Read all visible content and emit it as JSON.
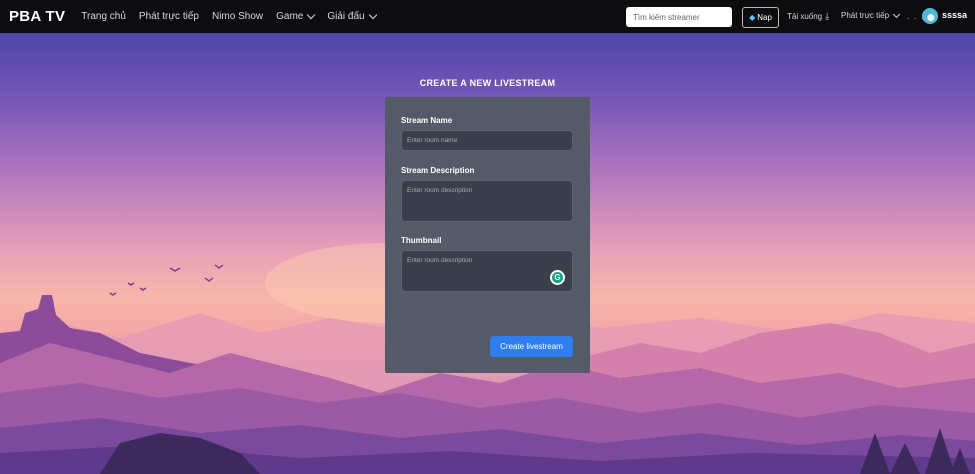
{
  "nav": {
    "logo": "PBA TV",
    "links": [
      "Trang chủ",
      "Phát trực tiếp",
      "Nimo Show",
      "Game",
      "Giải đấu"
    ],
    "search_placeholder": "Tìm kiếm streamer",
    "nap_label": "Nap",
    "download_label": "Tải xuống",
    "live_label": "Phát trực tiếp",
    "more_label": ". . .",
    "username": "ssssa"
  },
  "form": {
    "title": "CREATE A NEW LIVESTREAM",
    "stream_name_label": "Stream Name",
    "stream_name_placeholder": "Enter room name",
    "stream_description_label": "Stream Description",
    "stream_description_placeholder": "Enter room description",
    "thumbnail_label": "Thumbnail",
    "thumbnail_placeholder": "Enter room description",
    "submit_label": "Create livestream"
  },
  "icons": {
    "nap": "gem-icon",
    "download": "download-icon",
    "grammarly": "grammarly-icon",
    "dropdown": "chevron-down-icon"
  },
  "colors": {
    "nav_bg": "#0d0d10",
    "card_bg": "#545a68",
    "field_bg": "#3a3f4c",
    "accent": "#2e7ef0",
    "grammarly": "#14a37f"
  }
}
